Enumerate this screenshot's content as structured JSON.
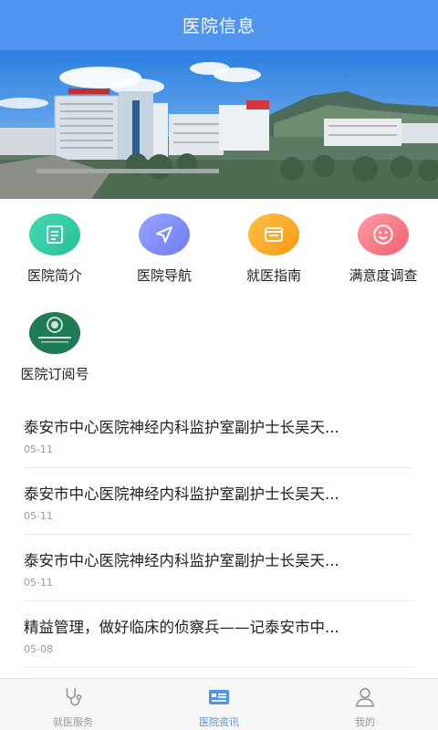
{
  "header": {
    "title": "医院信息"
  },
  "banner": {
    "alt": "hospital-photo"
  },
  "entries": [
    {
      "label": "医院简介",
      "icon": "document-icon",
      "color": "#2fc7a2"
    },
    {
      "label": "医院导航",
      "icon": "navigation-icon",
      "color": "#7e8bf6"
    },
    {
      "label": "就医指南",
      "icon": "guide-icon",
      "color": "#f8a82b"
    },
    {
      "label": "满意度调查",
      "icon": "smile-icon",
      "color": "#f26f7d"
    },
    {
      "label": "医院订阅号",
      "icon": "hospital-logo-icon",
      "color": "#1e7b54"
    }
  ],
  "news": [
    {
      "title": "泰安市中心医院神经内科监护室副护士长吴天...",
      "date": "05-11"
    },
    {
      "title": "泰安市中心医院神经内科监护室副护士长吴天...",
      "date": "05-11"
    },
    {
      "title": "泰安市中心医院神经内科监护室副护士长吴天...",
      "date": "05-11"
    },
    {
      "title": "精益管理，做好临床的侦察兵——记泰安市中...",
      "date": "05-08"
    }
  ],
  "tabbar": {
    "tabs": [
      {
        "label": "就医服务",
        "icon": "stethoscope-icon",
        "active": false
      },
      {
        "label": "医院资讯",
        "icon": "news-icon",
        "active": true
      },
      {
        "label": "我的",
        "icon": "person-icon",
        "active": false
      }
    ],
    "active_color": "#4f95ef"
  }
}
